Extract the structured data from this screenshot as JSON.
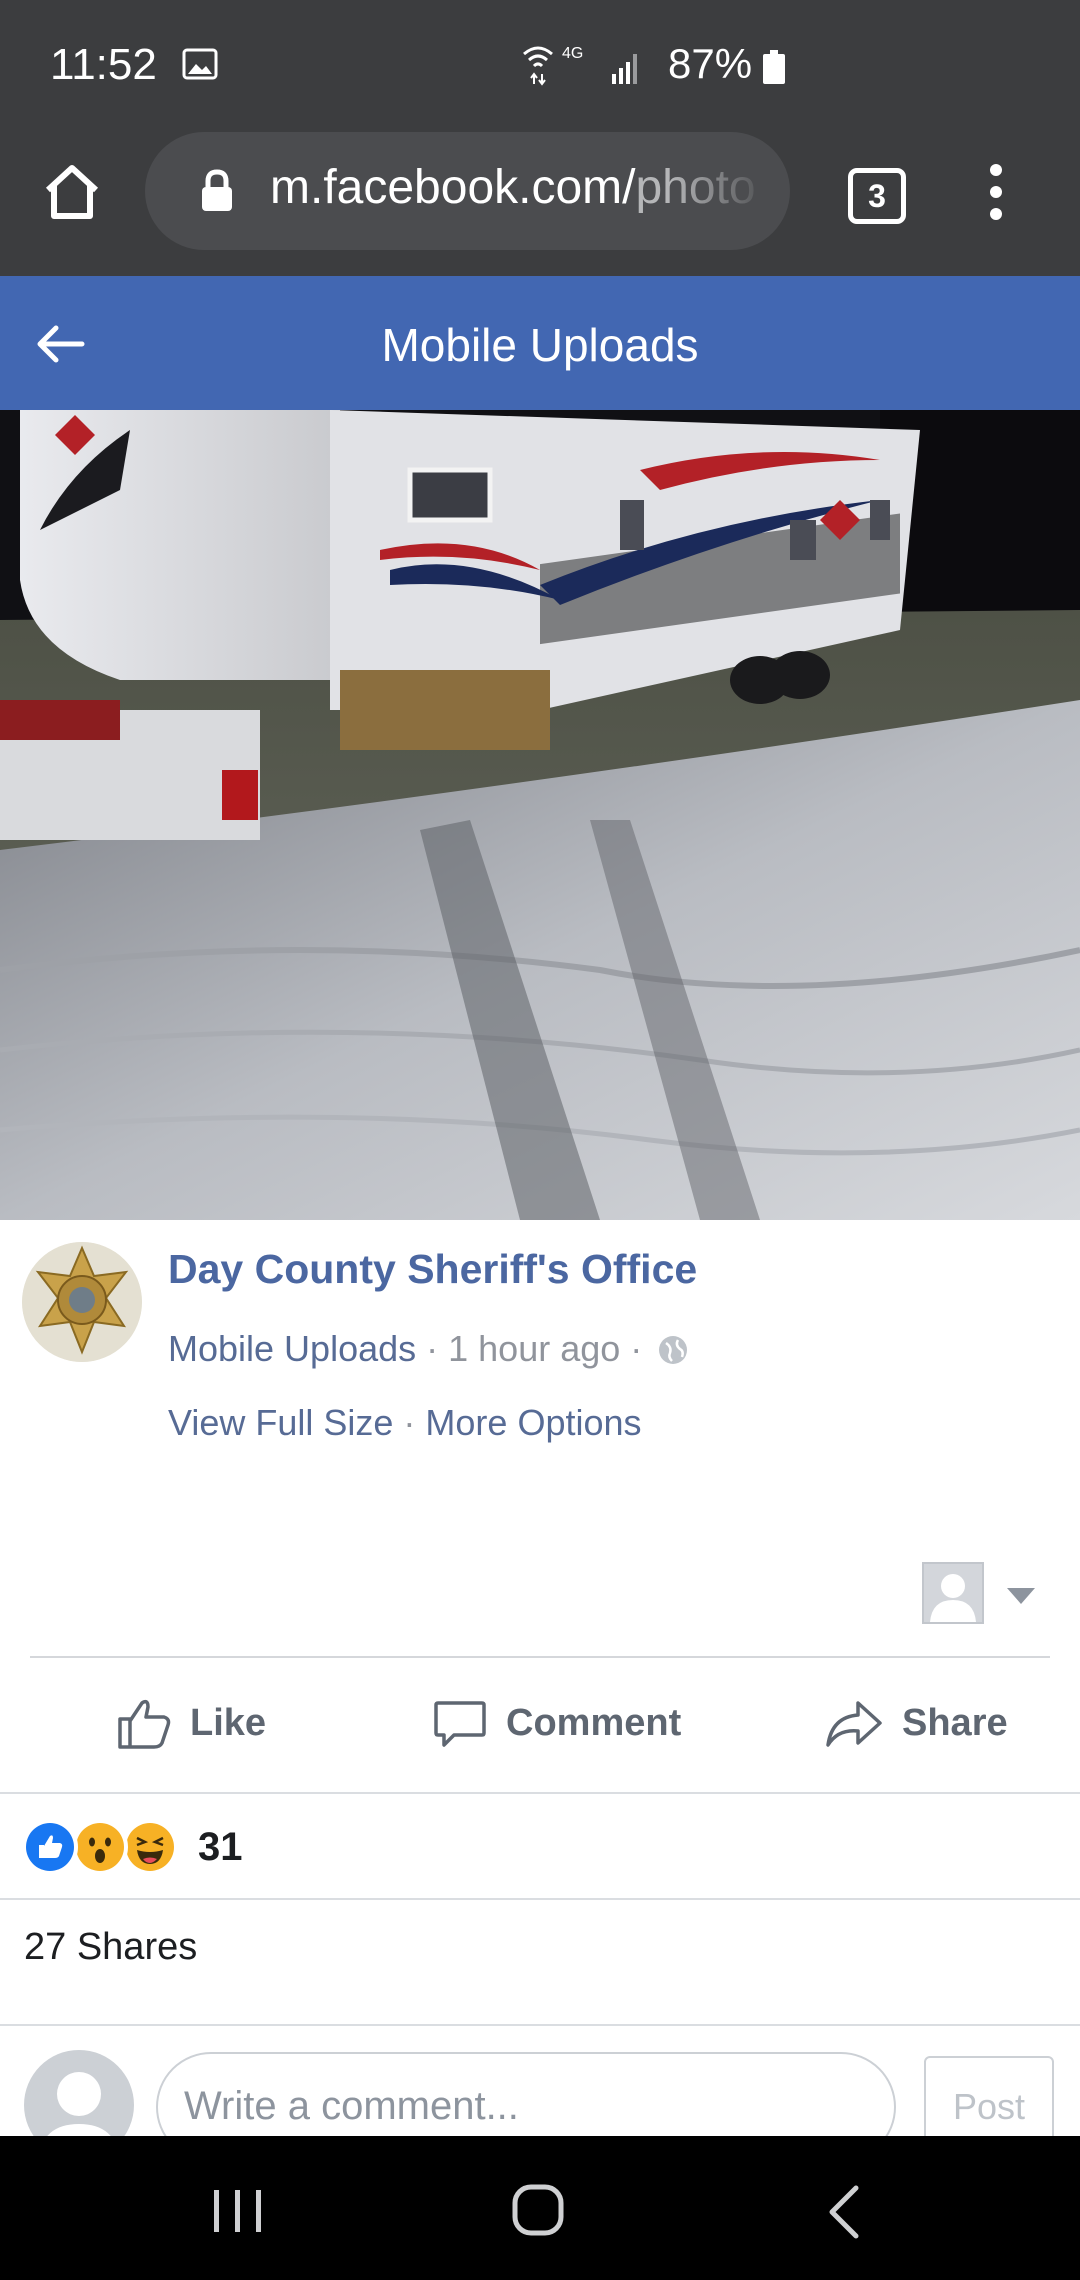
{
  "status_bar": {
    "time": "11:52",
    "network": "4G",
    "battery": "87%"
  },
  "browser": {
    "url_main": "m.facebook.com/",
    "url_rest": "photo",
    "tab_count": "3"
  },
  "header": {
    "title": "Mobile Uploads"
  },
  "post": {
    "page_name": "Day County Sheriff's Office",
    "album": "Mobile Uploads",
    "time_ago": "1 hour ago",
    "view_full_size": "View Full Size",
    "more_options": "More Options"
  },
  "actions": {
    "like": "Like",
    "comment": "Comment",
    "share": "Share"
  },
  "reactions": {
    "types": [
      "like",
      "wow",
      "haha"
    ],
    "count": "31"
  },
  "shares": "27 Shares",
  "comment_box": {
    "placeholder": "Write a comment...",
    "post_label": "Post"
  },
  "colors": {
    "facebook_blue": "#4267b2",
    "link_blue": "#576b95",
    "browser_chrome": "#3c3d3f"
  },
  "icons": [
    "image-icon",
    "wifi-icon",
    "signal-icon",
    "battery-icon",
    "home-icon",
    "lock-icon",
    "tabs-icon",
    "more-icon",
    "back-arrow-icon",
    "globe-icon",
    "tag-user-icon",
    "caret-down-icon",
    "like-icon",
    "comment-icon",
    "share-icon",
    "recents-icon",
    "nav-home-icon",
    "nav-back-icon"
  ]
}
